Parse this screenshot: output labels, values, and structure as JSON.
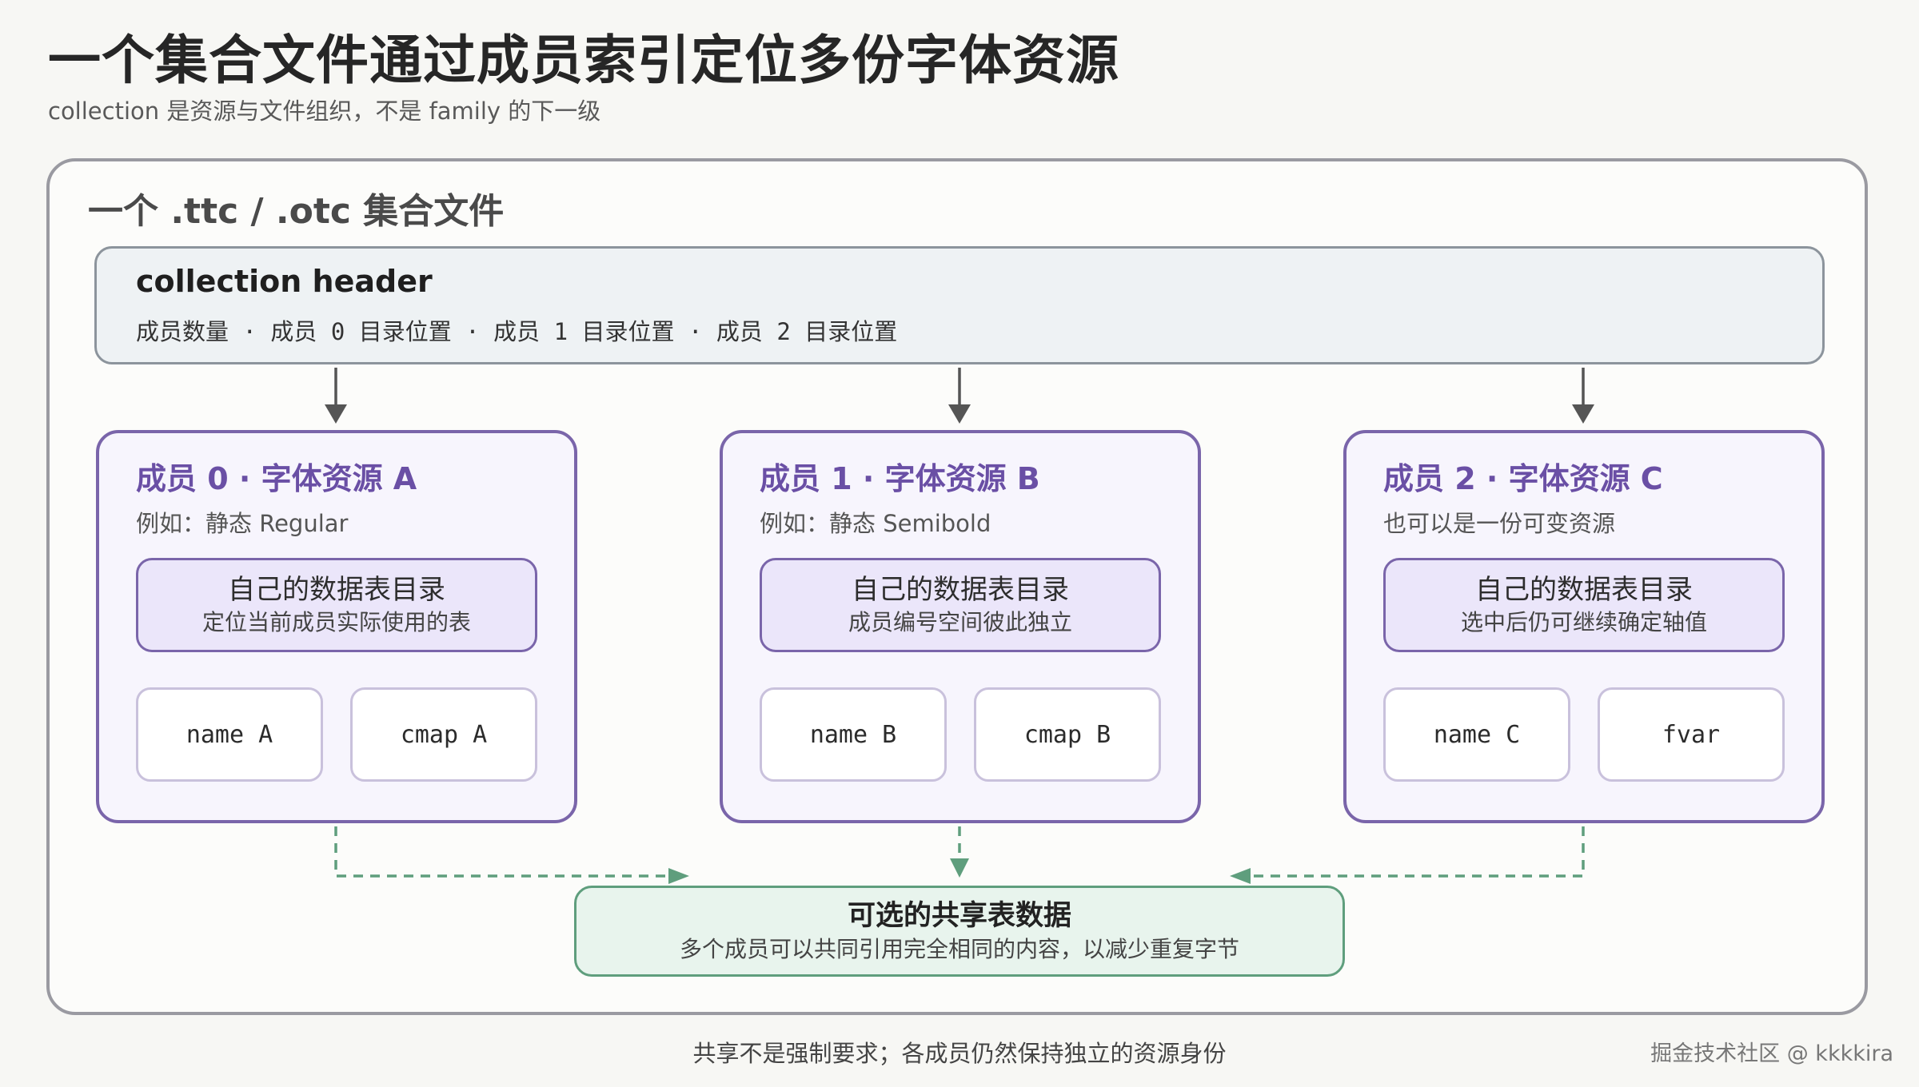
{
  "title": "一个集合文件通过成员索引定位多份字体资源",
  "subtitle": "collection 是资源与文件组织，不是 family 的下一级",
  "container": {
    "title": "一个 .ttc / .otc 集合文件"
  },
  "header": {
    "title": "collection header",
    "description": "成员数量 · 成员 0 目录位置 · 成员 1 目录位置 · 成员 2 目录位置"
  },
  "members": [
    {
      "title": "成员 0 · 字体资源 A",
      "subtitle": "例如：静态 Regular",
      "directory": {
        "title": "自己的数据表目录",
        "subtitle": "定位当前成员实际使用的表"
      },
      "tables": [
        "name A",
        "cmap A"
      ]
    },
    {
      "title": "成员 1 · 字体资源 B",
      "subtitle": "例如：静态 Semibold",
      "directory": {
        "title": "自己的数据表目录",
        "subtitle": "成员编号空间彼此独立"
      },
      "tables": [
        "name B",
        "cmap B"
      ]
    },
    {
      "title": "成员 2 · 字体资源 C",
      "subtitle": "也可以是一份可变资源",
      "directory": {
        "title": "自己的数据表目录",
        "subtitle": "选中后仍可继续确定轴值"
      },
      "tables": [
        "name C",
        "fvar"
      ]
    }
  ],
  "shared": {
    "title": "可选的共享表数据",
    "description": "多个成员可以共同引用完全相同的内容，以减少重复字节"
  },
  "footer_note": "共享不是强制要求；各成员仍然保持独立的资源身份",
  "watermark": "掘金技术社区 @ kkkkira",
  "colors": {
    "member_accent": "#7a65aa",
    "shared_accent": "#5f9e7d",
    "arrow": "#555555"
  }
}
